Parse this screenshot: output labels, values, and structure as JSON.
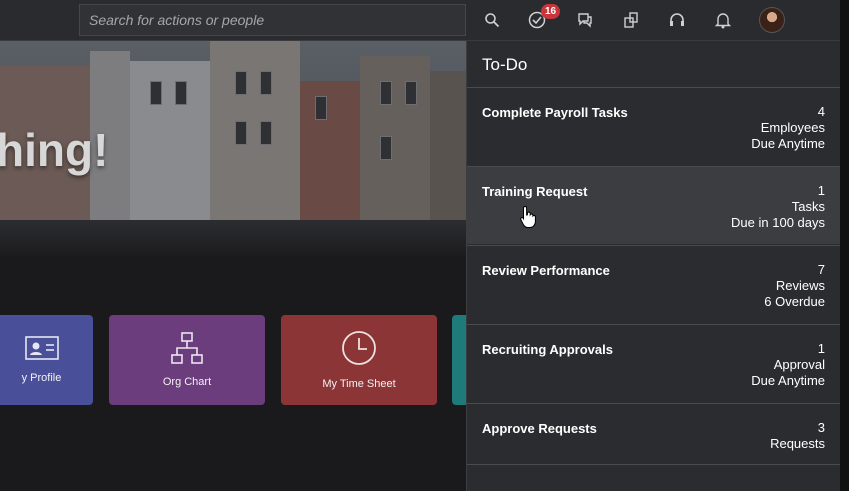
{
  "search": {
    "placeholder": "Search for actions or people"
  },
  "header": {
    "icons": [
      "search-icon",
      "todo-check-icon",
      "chat-icon",
      "pages-icon",
      "support-headset-icon",
      "notification-bell-icon"
    ],
    "todo_badge": "16"
  },
  "hero": {
    "greeting_fragment": "hing!"
  },
  "tiles": [
    {
      "label": "y Profile",
      "color": "#4a4f9a"
    },
    {
      "label": "Org Chart",
      "color": "#6b3d7d"
    },
    {
      "label": "My Time Sheet",
      "color": "#8c3536"
    },
    {
      "label": "",
      "color": "#1f7a7a"
    }
  ],
  "todo": {
    "title": "To-Do",
    "items": [
      {
        "name": "Complete Payroll Tasks",
        "count": "4",
        "unit": "Employees",
        "due": "Due Anytime"
      },
      {
        "name": "Training Request",
        "count": "1",
        "unit": "Tasks",
        "due": "Due in 100 days"
      },
      {
        "name": "Review Performance",
        "count": "7",
        "unit": "Reviews",
        "due": "6 Overdue"
      },
      {
        "name": "Recruiting Approvals",
        "count": "1",
        "unit": "Approval",
        "due": "Due Anytime"
      },
      {
        "name": "Approve Requests",
        "count": "3",
        "unit": "Requests",
        "due": ""
      }
    ]
  }
}
